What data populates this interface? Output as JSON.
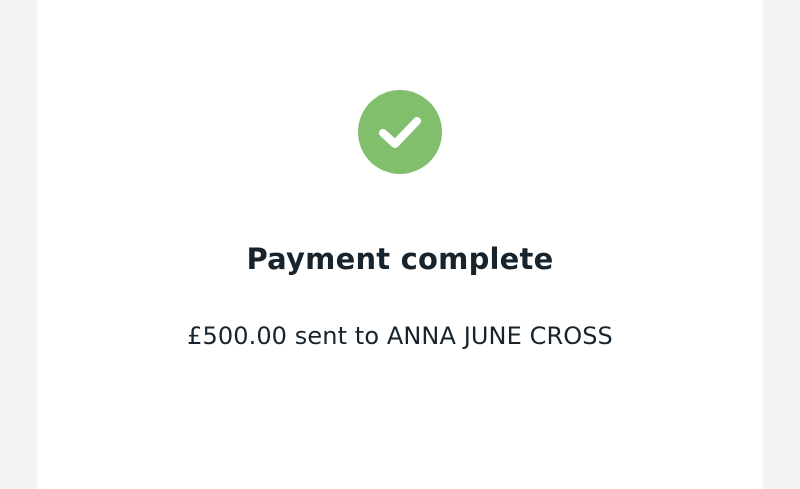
{
  "confirmation": {
    "icon": "check-circle-icon",
    "icon_color": "#82bf6c",
    "title": "Payment complete",
    "message": "£500.00 sent to ANNA JUNE CROSS"
  },
  "colors": {
    "background": "#f4f3f1",
    "card": "#ffffff",
    "text": "#17242e"
  }
}
